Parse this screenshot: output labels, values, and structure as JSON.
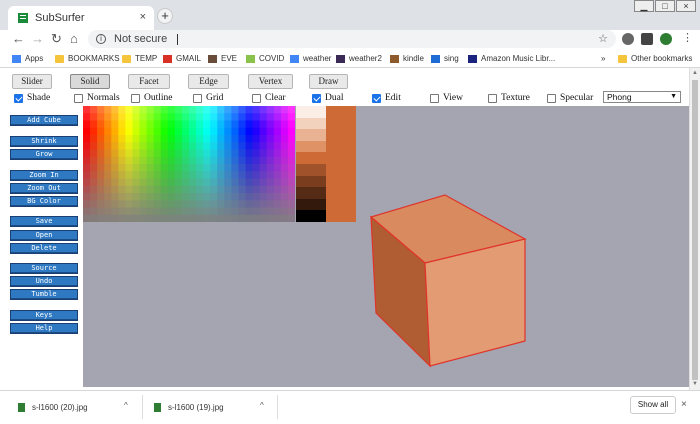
{
  "window": {
    "tab_title": "SubSurfer",
    "tab_close": "×",
    "new_tab": "+",
    "minimize": "▁",
    "maximize": "□",
    "close": "×"
  },
  "toolbar": {
    "back": "←",
    "forward": "→",
    "reload": "↻",
    "home": "⌂",
    "security_icon": "i",
    "security_text": "Not secure",
    "url": "",
    "star": "☆"
  },
  "bookmarks": {
    "items": [
      {
        "label": "Apps",
        "icon": "apps-icon"
      },
      {
        "label": "BOOKMARKS",
        "icon": "folder-icon"
      },
      {
        "label": "TEMP",
        "icon": "folder-icon"
      },
      {
        "label": "GMAIL",
        "icon": "gmail-icon"
      },
      {
        "label": "EVE",
        "icon": "eve-icon"
      },
      {
        "label": "COVID",
        "icon": "covid-icon"
      },
      {
        "label": "weather",
        "icon": "google-icon"
      },
      {
        "label": "weather2",
        "icon": "weather2-icon"
      },
      {
        "label": "kindle",
        "icon": "kindle-icon"
      },
      {
        "label": "sing",
        "icon": "sing-icon"
      },
      {
        "label": "Amazon Music Libr...",
        "icon": "amazon-music-icon"
      }
    ],
    "overflow": "»",
    "other": "Other bookmarks"
  },
  "modes": [
    "Slider",
    "Solid",
    "Facet",
    "Edge",
    "Vertex",
    "Draw"
  ],
  "active_mode": "Solid",
  "options": [
    {
      "label": "Shade",
      "checked": true
    },
    {
      "label": "Normals",
      "checked": false
    },
    {
      "label": "Outline",
      "checked": false
    },
    {
      "label": "Grid",
      "checked": false
    },
    {
      "label": "Clear",
      "checked": false
    },
    {
      "label": "Dual",
      "checked": true
    },
    {
      "label": "Edit",
      "checked": true
    },
    {
      "label": "View",
      "checked": false
    },
    {
      "label": "Texture",
      "checked": false
    },
    {
      "label": "Specular",
      "checked": false
    }
  ],
  "shading": {
    "selected": "Phong",
    "arrow": "▼"
  },
  "sidebar": {
    "groups": [
      [
        "Add Cube"
      ],
      [
        "Shrink",
        "Grow"
      ],
      [
        "Zoom In",
        "Zoom Out",
        "BG Color"
      ],
      [
        "Save",
        "Open",
        "Delete"
      ],
      [
        "Source",
        "Undo",
        "Tumble"
      ],
      [
        "Keys",
        "Help"
      ]
    ]
  },
  "colors": {
    "viewport_bg": "#a4a5b1",
    "current_color": "#cd6a36",
    "cube_front": "#e29b72",
    "cube_top": "#d98a5f",
    "cube_side": "#b05d34",
    "cube_edge": "#e0332a",
    "swatches": [
      "#fbeee6",
      "#f2d2bd",
      "#e8b293",
      "#de9266",
      "#cd6a36",
      "#a0522a",
      "#7a3e1f",
      "#552b15",
      "#33190c",
      "#000000"
    ]
  },
  "downloads": {
    "items": [
      {
        "label": "s-l1600 (20).jpg"
      },
      {
        "label": "s-l1600 (19).jpg"
      }
    ],
    "show_all": "Show all",
    "close": "×",
    "chevron": "^"
  }
}
